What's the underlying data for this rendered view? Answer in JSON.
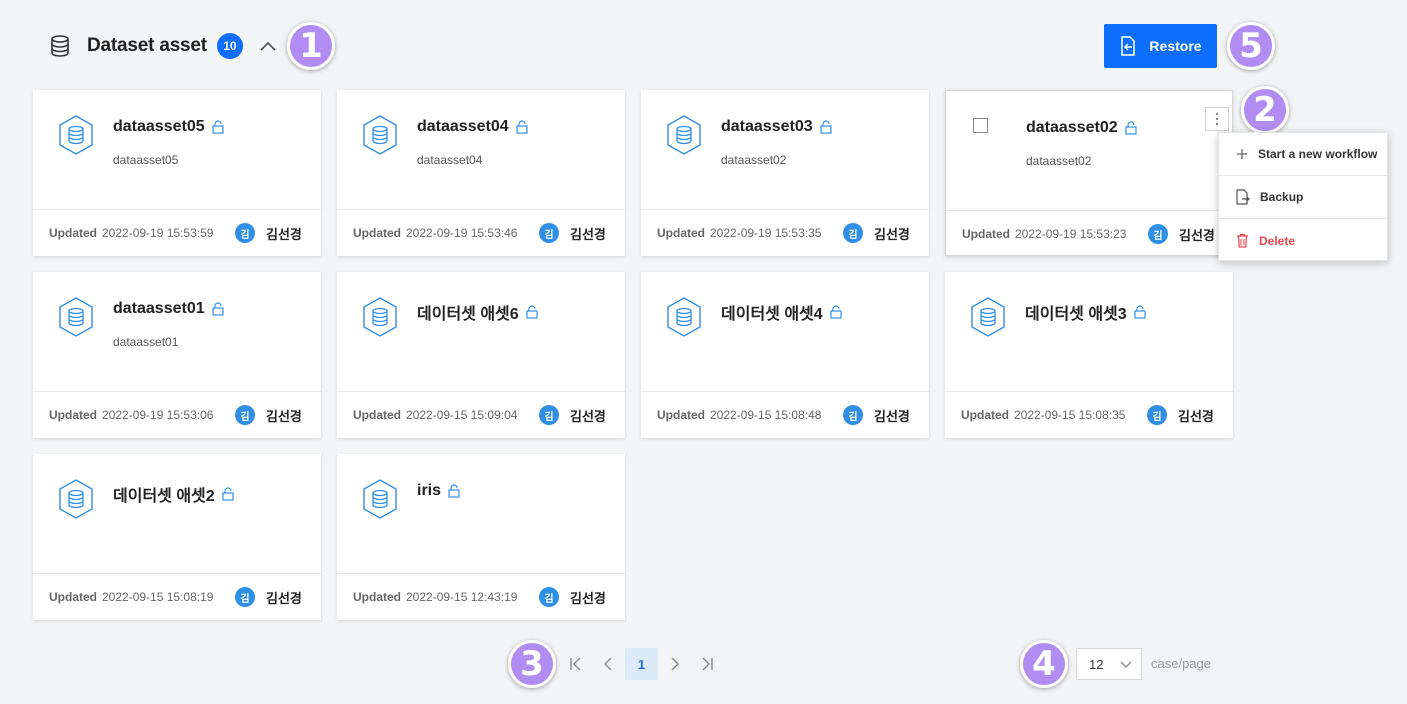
{
  "header": {
    "title": "Dataset asset",
    "count": "10",
    "icon": "database-icon",
    "collapse_icon": "chevron-up-icon"
  },
  "restore_button": {
    "label": "Restore",
    "icon": "restore-icon"
  },
  "markers": [
    "1",
    "2",
    "3",
    "4",
    "5"
  ],
  "updated_label": "Updated",
  "cards": [
    {
      "name": "dataasset05",
      "desc": "dataasset05",
      "date": "2022-09-19 15:53:59",
      "avatar": "김",
      "owner": "김선경"
    },
    {
      "name": "dataasset04",
      "desc": "dataasset04",
      "date": "2022-09-19 15:53:46",
      "avatar": "김",
      "owner": "김선경"
    },
    {
      "name": "dataasset03",
      "desc": "dataasset02",
      "date": "2022-09-19 15:53:35",
      "avatar": "김",
      "owner": "김선경"
    },
    {
      "name": "dataasset02",
      "desc": "dataasset02",
      "date": "2022-09-19 15:53:23",
      "avatar": "김",
      "owner": "김선경"
    },
    {
      "name": "dataasset01",
      "desc": "dataasset01",
      "date": "2022-09-19 15:53:06",
      "avatar": "김",
      "owner": "김선경"
    },
    {
      "name": "데이터셋 애셋6",
      "desc": "",
      "date": "2022-09-15 15:09:04",
      "avatar": "김",
      "owner": "김선경"
    },
    {
      "name": "데이터셋 애셋4",
      "desc": "",
      "date": "2022-09-15 15:08:48",
      "avatar": "김",
      "owner": "김선경"
    },
    {
      "name": "데이터셋 애셋3",
      "desc": "",
      "date": "2022-09-15 15:08:35",
      "avatar": "김",
      "owner": "김선경"
    },
    {
      "name": "데이터셋 애셋2",
      "desc": "",
      "date": "2022-09-15 15:08:19",
      "avatar": "김",
      "owner": "김선경"
    },
    {
      "name": "iris",
      "desc": "",
      "date": "2022-09-15 12:43:19",
      "avatar": "김",
      "owner": "김선경"
    }
  ],
  "context_menu": {
    "items": [
      {
        "label": "Start a new workflow",
        "icon": "plus-icon"
      },
      {
        "label": "Backup",
        "icon": "backup-icon"
      },
      {
        "label": "Delete",
        "icon": "trash-icon"
      }
    ]
  },
  "pagination": {
    "current_page": "1"
  },
  "per_page": {
    "value": "12",
    "label": "case/page"
  },
  "colors": {
    "accent": "#0d6efd",
    "marker": "#b18cf2",
    "danger": "#e5484d",
    "avatar": "#2f8fe5"
  }
}
